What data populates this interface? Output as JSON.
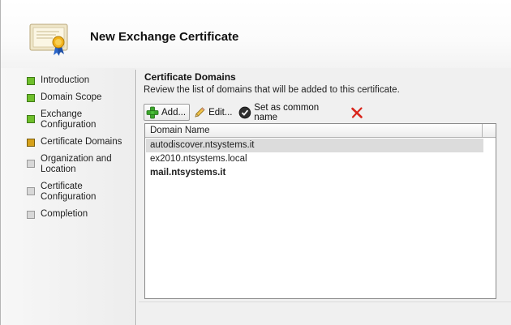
{
  "header": {
    "title": "New Exchange Certificate",
    "icon": "certificate-icon"
  },
  "nav": {
    "items": [
      {
        "label": "Introduction",
        "state": "done"
      },
      {
        "label": "Domain Scope",
        "state": "done"
      },
      {
        "label": "Exchange\nConfiguration",
        "state": "done"
      },
      {
        "label": "Certificate Domains",
        "state": "active"
      },
      {
        "label": "Organization and\nLocation",
        "state": "pending"
      },
      {
        "label": "Certificate\nConfiguration",
        "state": "pending"
      },
      {
        "label": "Completion",
        "state": "pending"
      }
    ]
  },
  "content": {
    "title": "Certificate Domains",
    "description": "Review the list of domains that will be added to this certificate."
  },
  "toolbar": {
    "add_label": "Add...",
    "edit_label": "Edit...",
    "common_name_label": "Set as common name",
    "add_icon": "plus-icon",
    "edit_icon": "pencil-icon",
    "common_name_icon": "checkmark-circle-icon",
    "remove_icon": "delete-x-icon"
  },
  "list": {
    "column": "Domain Name",
    "rows": [
      {
        "value": "autodiscover.ntsystems.it",
        "selected": true,
        "bold": false
      },
      {
        "value": "ex2010.ntsystems.local",
        "selected": false,
        "bold": false
      },
      {
        "value": "mail.ntsystems.it",
        "selected": false,
        "bold": true
      }
    ]
  },
  "colors": {
    "done": "#6fbf2b",
    "active": "#d6a11a",
    "pending": "#d8d8d8",
    "remove": "#d9261c"
  }
}
